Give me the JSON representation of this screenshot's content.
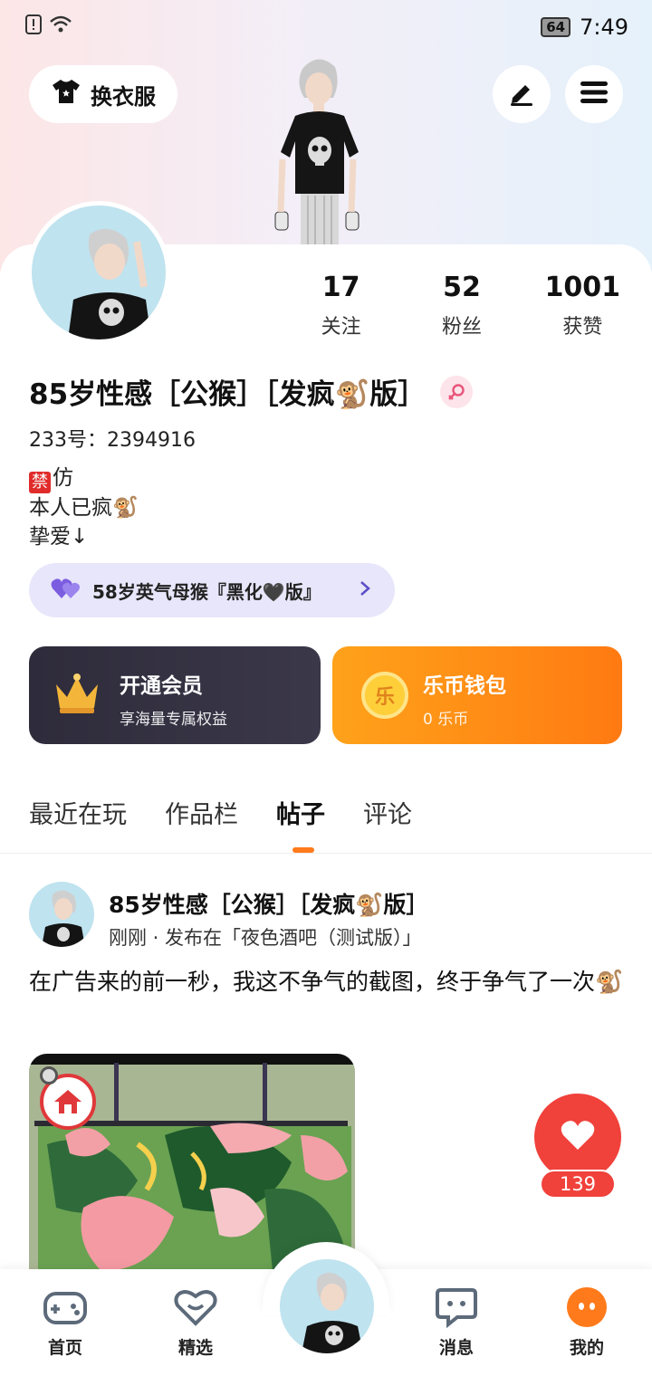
{
  "status_bar": {
    "battery": "64",
    "time": "7:49"
  },
  "header": {
    "outfit_label": "换衣服"
  },
  "profile": {
    "stats": [
      {
        "value": "17",
        "label": "关注"
      },
      {
        "value": "52",
        "label": "粉丝"
      },
      {
        "value": "1001",
        "label": "获赞"
      }
    ],
    "username": "85岁性感［公猴］［发疯🐒版］",
    "uid": "233号：2394916",
    "bio_line1_badge": "禁",
    "bio_line1": "仿",
    "bio_line2": "本人已疯🐒",
    "bio_line3": "挚爱↓",
    "pinned_friend": "58岁英气母猴『黑化🖤版』"
  },
  "cards": {
    "vip_title": "开通会员",
    "vip_sub": "享海量专属权益",
    "wallet_title": "乐币钱包",
    "wallet_sub": "0 乐币",
    "wallet_coin": "乐"
  },
  "tabs": [
    "最近在玩",
    "作品栏",
    "帖子",
    "评论"
  ],
  "active_tab": "帖子",
  "post": {
    "author": "85岁性感［公猴］［发疯🐒版］",
    "meta": "刚刚 · 发布在「夜色酒吧（测试版）」",
    "text": "在广告来的前一秒，我这不争气的截图，终于争气了一次🐒",
    "likes": "139"
  },
  "bottom_nav": [
    {
      "label": "首页",
      "icon": "gamepad-icon"
    },
    {
      "label": "精选",
      "icon": "heart-chat-icon"
    },
    {
      "label": "",
      "icon": "avatar-center"
    },
    {
      "label": "消息",
      "icon": "message-icon"
    },
    {
      "label": "我的",
      "icon": "profile-face-icon"
    }
  ],
  "colors": {
    "accent": "#ff7a1a",
    "like": "#f0413b",
    "vip_bg": "#2e2b3b",
    "wallet_bg": "#ff8a16"
  }
}
